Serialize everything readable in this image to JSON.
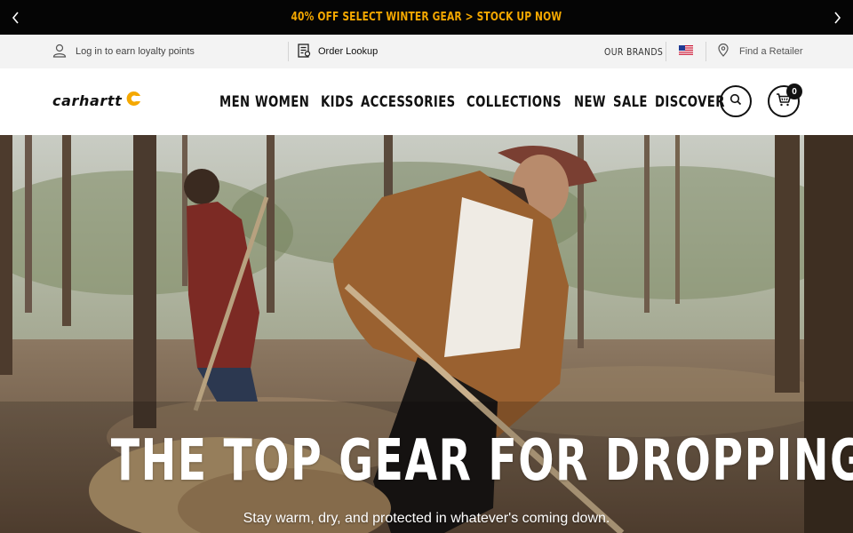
{
  "promo": {
    "text": "40% OFF SELECT WINTER GEAR > STOCK UP NOW",
    "prev_icon": "chevron-left-icon",
    "next_icon": "chevron-right-icon",
    "background": "#050505",
    "text_color": "#f5a800"
  },
  "utility": {
    "login_label": "Log in to earn loyalty points",
    "order_lookup_label": "Order Lookup",
    "brands_label": "OUR BRANDS",
    "retailer_label": "Find a Retailer",
    "flag": "us-flag-icon"
  },
  "header": {
    "logo_text": "carhartt",
    "logo_color": "#f5a800",
    "nav": [
      {
        "label": "MEN"
      },
      {
        "label": "WOMEN"
      },
      {
        "label": "KIDS"
      },
      {
        "label": "ACCESSORIES"
      },
      {
        "label": "COLLECTIONS"
      },
      {
        "label": "NEW"
      },
      {
        "label": "SALE"
      },
      {
        "label": "DISCOVER"
      }
    ],
    "cart_count": "0"
  },
  "hero": {
    "title": "THE TOP GEAR FOR DROPPING TEMPS",
    "subtitle": "Stay warm, dry, and protected in whatever's coming down."
  }
}
